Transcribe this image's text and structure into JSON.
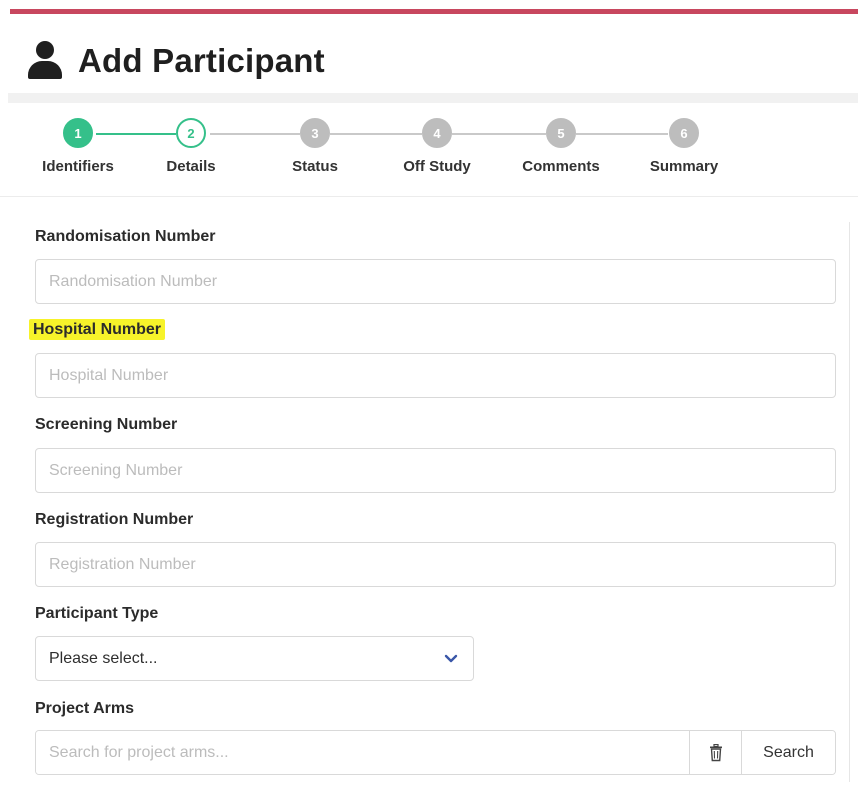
{
  "colors": {
    "accent_bar": "#c8475f",
    "step_done": "#35c08a",
    "step_todo": "#bdbdbd",
    "highlight": "#f7f32a"
  },
  "header": {
    "icon": "user-icon",
    "title": "Add Participant"
  },
  "stepper": {
    "steps": [
      {
        "number": "1",
        "label": "Identifiers",
        "state": "done"
      },
      {
        "number": "2",
        "label": "Details",
        "state": "active"
      },
      {
        "number": "3",
        "label": "Status",
        "state": "todo"
      },
      {
        "number": "4",
        "label": "Off Study",
        "state": "todo"
      },
      {
        "number": "5",
        "label": "Comments",
        "state": "todo"
      },
      {
        "number": "6",
        "label": "Summary",
        "state": "todo"
      }
    ]
  },
  "form": {
    "randomisation": {
      "label": "Randomisation Number",
      "placeholder": "Randomisation Number",
      "value": ""
    },
    "hospital": {
      "label": "Hospital Number",
      "placeholder": "Hospital Number",
      "value": "",
      "highlighted": true
    },
    "screening": {
      "label": "Screening Number",
      "placeholder": "Screening Number",
      "value": ""
    },
    "registration": {
      "label": "Registration Number",
      "placeholder": "Registration Number",
      "value": ""
    },
    "participant_type": {
      "label": "Participant Type",
      "selected": "Please select...",
      "icon": "chevron-down-icon"
    },
    "project_arms": {
      "label": "Project Arms",
      "placeholder": "Search for project arms...",
      "clear_icon": "trash-icon",
      "search_label": "Search"
    }
  }
}
